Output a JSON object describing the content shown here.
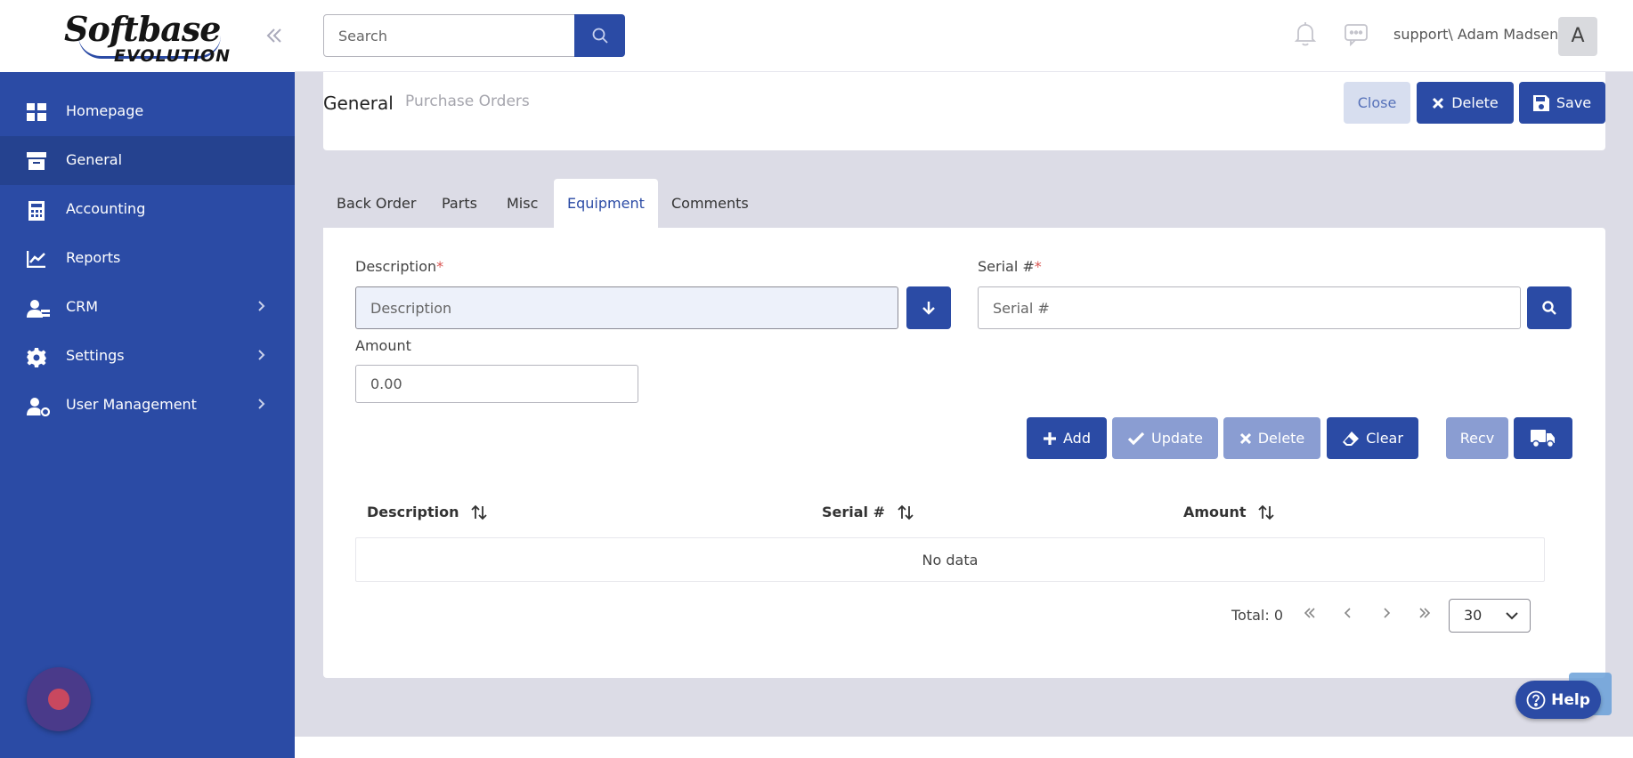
{
  "logo": {
    "line1": "Softbase",
    "line2": "EVOLUTION"
  },
  "sidebar": {
    "items": [
      {
        "label": "Homepage",
        "icon": "grid-icon"
      },
      {
        "label": "General",
        "icon": "archive-icon",
        "active": true
      },
      {
        "label": "Accounting",
        "icon": "calculator-icon"
      },
      {
        "label": "Reports",
        "icon": "chart-icon"
      },
      {
        "label": "CRM",
        "icon": "users-icon",
        "has_children": true
      },
      {
        "label": "Settings",
        "icon": "gear-icon",
        "has_children": true
      },
      {
        "label": "User Management",
        "icon": "user-cog-icon",
        "has_children": true
      }
    ]
  },
  "topbar": {
    "search_placeholder": "Search",
    "user": "support\\ Adam Madsen",
    "avatar_letter": "A"
  },
  "header": {
    "breadcrumb_current": "General",
    "breadcrumb_link": "Purchase Orders",
    "close_label": "Close",
    "delete_label": "Delete",
    "save_label": "Save"
  },
  "tabs": [
    "Back Order",
    "Parts",
    "Misc",
    "Equipment",
    "Comments"
  ],
  "active_tab": "Equipment",
  "form": {
    "description_label": "Description",
    "description_placeholder": "Description",
    "serial_label": "Serial #",
    "serial_placeholder": "Serial #",
    "amount_label": "Amount",
    "amount_value": "0.00",
    "required_mark": "*"
  },
  "actions": {
    "add": "Add",
    "update": "Update",
    "delete": "Delete",
    "clear": "Clear",
    "recv": "Recv"
  },
  "table": {
    "columns": [
      "Description",
      "Serial #",
      "Amount"
    ],
    "empty_text": "No data"
  },
  "pagination": {
    "total": "Total: 0",
    "page_size": "30"
  },
  "help": {
    "label": "Help"
  },
  "colors": {
    "primary": "#2b4ba5",
    "disabled": "#8a9dd2",
    "required": "#d9534f"
  }
}
